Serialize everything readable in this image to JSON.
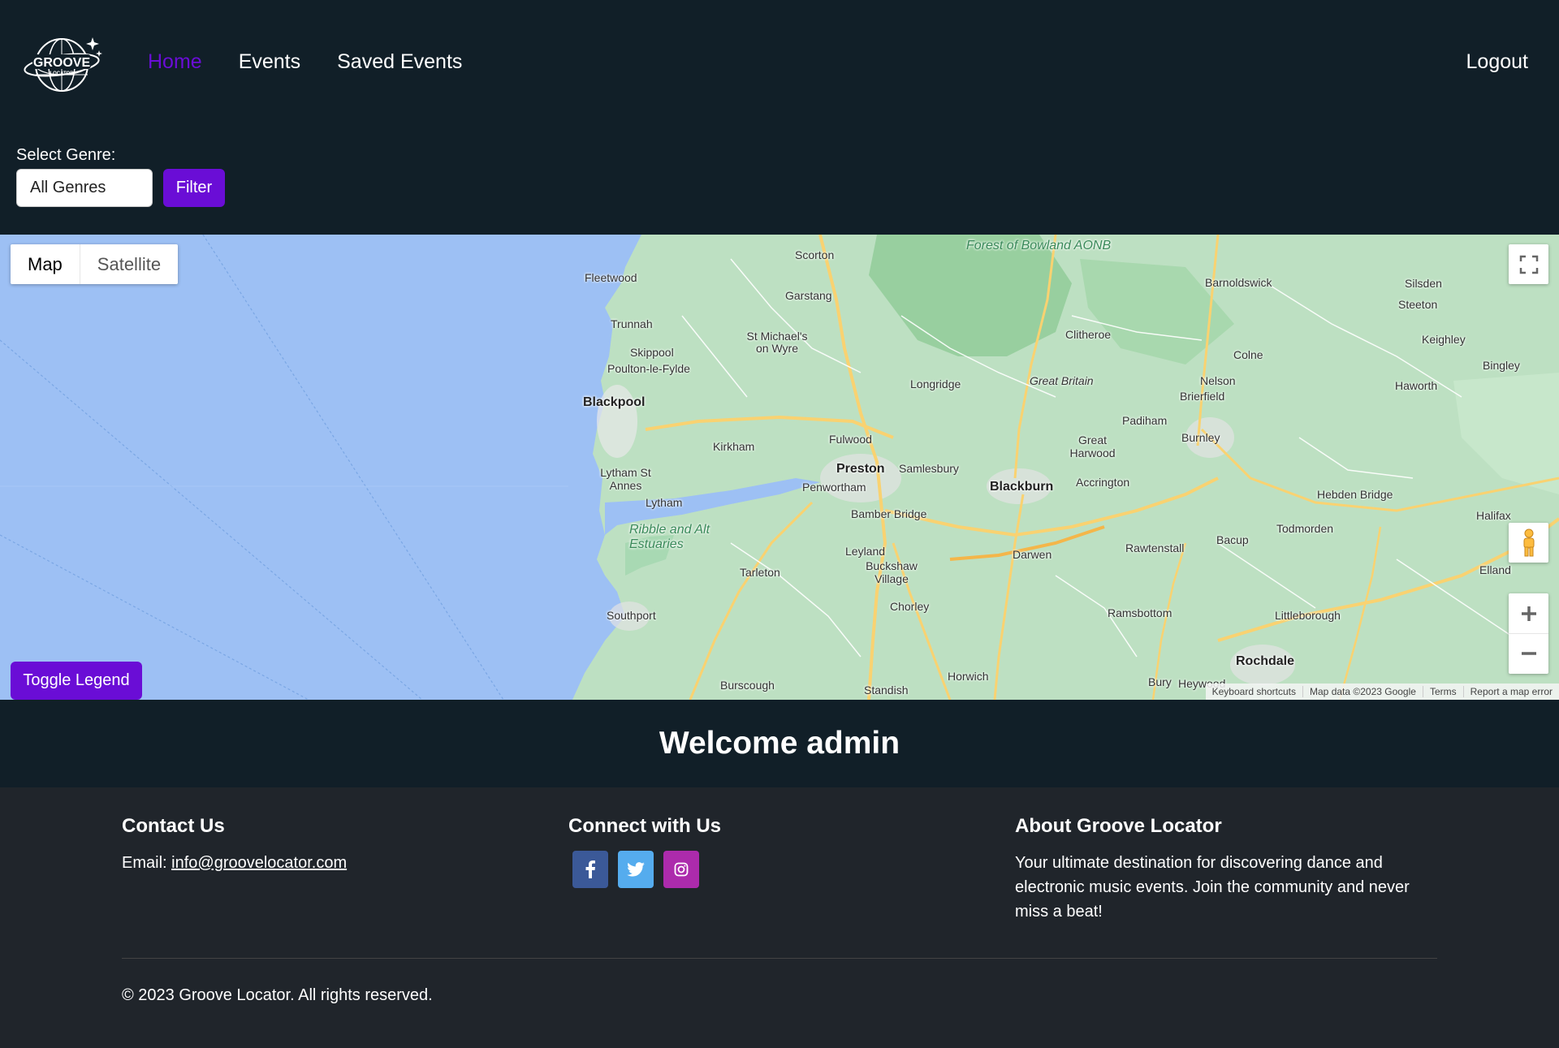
{
  "nav": {
    "logo_text": "GROOVE",
    "logo_subtext": "LOCATOR",
    "links": [
      {
        "label": "Home",
        "active": true
      },
      {
        "label": "Events",
        "active": false
      },
      {
        "label": "Saved Events",
        "active": false
      }
    ],
    "logout": "Logout",
    "active_color": "#6a0dd6"
  },
  "filter": {
    "label": "Select Genre:",
    "selected": "All Genres",
    "button": "Filter"
  },
  "map": {
    "type_buttons": [
      "Map",
      "Satellite"
    ],
    "active_type": "Map",
    "toggle_legend": "Toggle Legend",
    "attribution": [
      "Keyboard shortcuts",
      "Map data ©2023 Google",
      "Terms",
      "Report a map error"
    ],
    "places": {
      "fleetwood": "Fleetwood",
      "scorton": "Scorton",
      "forest": "Forest of Bowland AONB",
      "barnoldswick": "Barnoldswick",
      "silsden": "Silsden",
      "steeton": "Steeton",
      "trunnah": "Trunnah",
      "garstang": "Garstang",
      "skippool": "Skippool",
      "stmichaels": "St Michael's on Wyre",
      "clitheroe": "Clitheroe",
      "colne": "Colne",
      "keighley": "Keighley",
      "poulton": "Poulton-le-Fylde",
      "longridge": "Longridge",
      "greatbritain": "Great Britain",
      "nelson": "Nelson",
      "bingley": "Bingley",
      "blackpool": "Blackpool",
      "brierfield": "Brierfield",
      "haworth": "Haworth",
      "padiham": "Padiham",
      "fulwood": "Fulwood",
      "kirkham": "Kirkham",
      "greatharwood": "Great Harwood",
      "burnley": "Burnley",
      "preston": "Preston",
      "samlesbury": "Samlesbury",
      "lytham_st_annes": "Lytham St Annes",
      "penwortham": "Penwortham",
      "blackburn": "Blackburn",
      "accrington": "Accrington",
      "hebdenbridge": "Hebden Bridge",
      "lytham": "Lytham",
      "ribble": "Ribble and Alt Estuaries",
      "bamberbridge": "Bamber Bridge",
      "halifax": "Halifax",
      "todmorden": "Todmorden",
      "leyland": "Leyland",
      "darwen": "Darwen",
      "rawtenstall": "Rawtenstall",
      "bacup": "Bacup",
      "bucks": "Buckshaw Village",
      "tarleton": "Tarleton",
      "elland": "Elland",
      "chorley": "Chorley",
      "southport": "Southport",
      "ramsbottom": "Ramsbottom",
      "littleborough": "Littleborough",
      "rochdale": "Rochdale",
      "horwich": "Horwich",
      "burscough": "Burscough",
      "standish": "Standish",
      "bury": "Bury",
      "heywood": "Heywood"
    }
  },
  "welcome": "Welcome admin",
  "footer": {
    "contact": {
      "title": "Contact Us",
      "email_label": "Email:",
      "email": "info@groovelocator.com"
    },
    "connect": {
      "title": "Connect with Us",
      "facebook_color": "#3b5998",
      "twitter_color": "#55acee",
      "instagram_color": "#ac2bac"
    },
    "about": {
      "title": "About Groove Locator",
      "text": "Your ultimate destination for discovering dance and electronic music events. Join the community and never miss a beat!"
    },
    "copyright": "© 2023 Groove Locator. All rights reserved."
  }
}
